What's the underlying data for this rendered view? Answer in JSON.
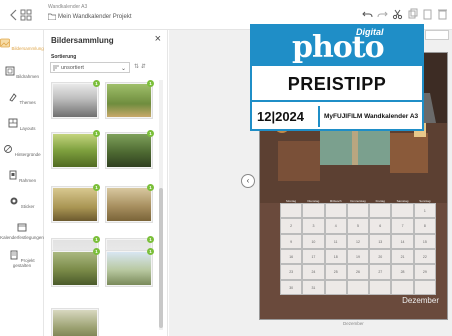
{
  "topbar": {
    "project_label": "Wandkalender A3",
    "project_name": "Mein Wandkalender Projekt"
  },
  "nav": {
    "items": [
      {
        "label": "Bildersammlung",
        "icon": "images-icon",
        "active": true
      },
      {
        "label": "Bildrahmen",
        "icon": "frame-icon"
      },
      {
        "label": "Themes",
        "icon": "themes-icon"
      },
      {
        "label": "Layouts",
        "icon": "layouts-icon"
      },
      {
        "label": "Hintergründe",
        "icon": "background-icon"
      },
      {
        "label": "Rahmen",
        "icon": "rahmen-icon"
      },
      {
        "label": "Sticker",
        "icon": "sticker-icon"
      },
      {
        "label": "Kalenderfestlegungen",
        "icon": "calendar-settings-icon"
      },
      {
        "label": "Projekt gestalten",
        "icon": "project-icon"
      }
    ]
  },
  "panel": {
    "title": "Bildersammlung",
    "sort_label": "Sortierung",
    "sort_value": "unsortiert"
  },
  "thumbnails": [
    {
      "badge": "1"
    },
    {
      "badge": "1"
    },
    {
      "badge": "1"
    },
    {
      "badge": "1"
    },
    {
      "badge": "1"
    },
    {
      "badge": "1"
    },
    {
      "badge": "1"
    },
    {
      "badge": "1"
    },
    {
      "badge": "1"
    },
    {
      "badge": "1"
    }
  ],
  "calendar": {
    "weekdays": [
      "Montag",
      "Dienstag",
      "Mittwoch",
      "Donnerstag",
      "Freitag",
      "Samstag",
      "Sonntag"
    ],
    "days": [
      "",
      "",
      "",
      "",
      "",
      "",
      "1",
      "2",
      "3",
      "4",
      "5",
      "6",
      "7",
      "8",
      "9",
      "10",
      "11",
      "12",
      "13",
      "14",
      "15",
      "16",
      "17",
      "18",
      "19",
      "20",
      "21",
      "22",
      "23",
      "24",
      "25",
      "26",
      "27",
      "28",
      "29",
      "30",
      "31",
      "",
      "",
      "",
      "",
      ""
    ],
    "month": "Dezember",
    "caption": "Dezember"
  },
  "award": {
    "digital": "Digital",
    "photo": "photo",
    "title": "PREISTIPP",
    "year": "12|2024",
    "product": "MyFUJIFILM Wandkalender A3"
  },
  "colors": {
    "accent_blue": "#1f8ec7",
    "badge_green": "#7bbf3a",
    "active_nav": "#e0a64a"
  }
}
